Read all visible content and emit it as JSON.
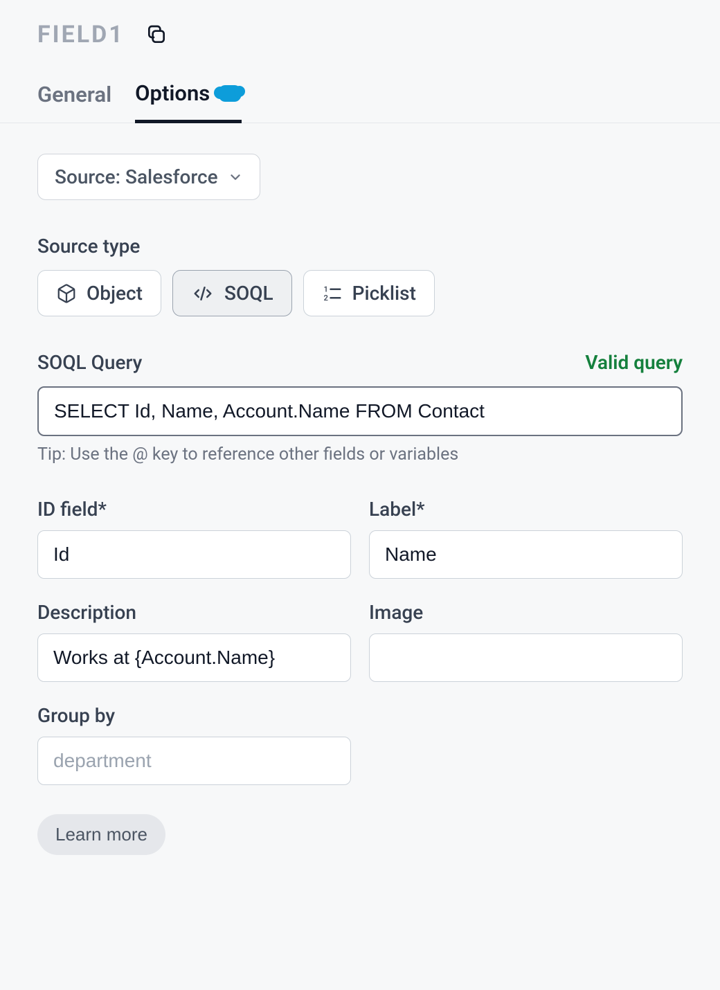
{
  "header": {
    "title": "FIELD1"
  },
  "tabs": {
    "general": "General",
    "options": "Options"
  },
  "source": {
    "selector_label": "Source: Salesforce"
  },
  "source_type": {
    "label": "Source type",
    "object": "Object",
    "soql": "SOQL",
    "picklist": "Picklist"
  },
  "query": {
    "label": "SOQL Query",
    "status": "Valid query",
    "value": "SELECT Id, Name, Account.Name FROM Contact",
    "tip": "Tip: Use the @ key to reference other fields or variables"
  },
  "fields": {
    "id_label": "ID field*",
    "id_value": "Id",
    "label_label": "Label*",
    "label_value": "Name",
    "description_label": "Description",
    "description_value": "Works at {Account.Name}",
    "image_label": "Image",
    "image_value": "",
    "group_by_label": "Group by",
    "group_by_placeholder": "department"
  },
  "footer": {
    "learn_more": "Learn more"
  }
}
